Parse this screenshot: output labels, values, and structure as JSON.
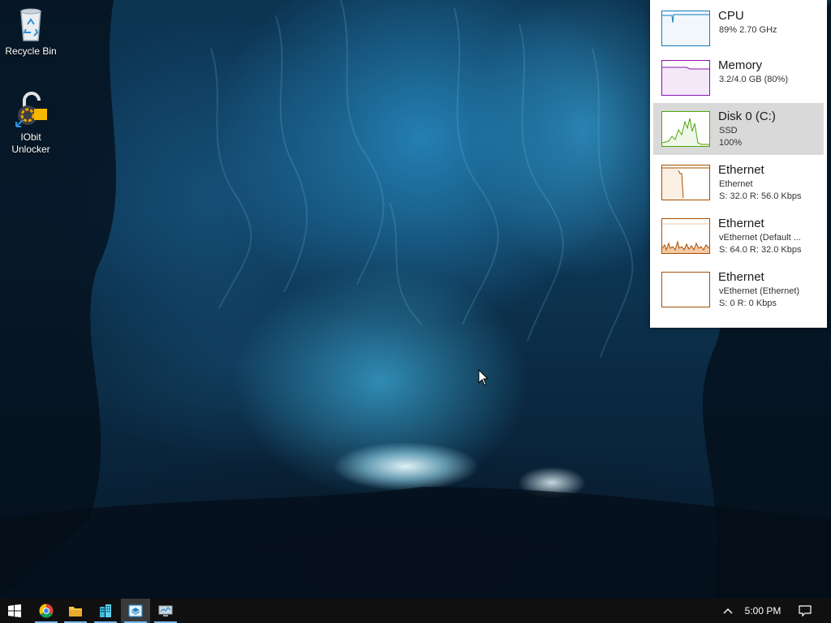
{
  "desktop": {
    "icons": [
      {
        "label": "Recycle Bin",
        "icon": "recycle-bin-icon"
      },
      {
        "label": "IObit Unlocker",
        "icon": "iobit-unlocker-icon"
      }
    ]
  },
  "flyout": {
    "items": [
      {
        "title": "CPU",
        "line1": "89%  2.70 GHz",
        "line2": "",
        "color": "#117dbb",
        "selected": false
      },
      {
        "title": "Memory",
        "line1": "3.2/4.0 GB (80%)",
        "line2": "",
        "color": "#8b12ae",
        "selected": false
      },
      {
        "title": "Disk 0 (C:)",
        "line1": "SSD",
        "line2": "100%",
        "color": "#4da60c",
        "selected": true
      },
      {
        "title": "Ethernet",
        "line1": "Ethernet",
        "line2": "S: 32.0  R: 56.0 Kbps",
        "color": "#a74f01",
        "selected": false
      },
      {
        "title": "Ethernet",
        "line1": "vEthernet (Default ...",
        "line2": "S: 64.0  R: 32.0 Kbps",
        "color": "#a74f01",
        "selected": false
      },
      {
        "title": "Ethernet",
        "line1": "vEthernet (Ethernet)",
        "line2": "S: 0  R: 0 Kbps",
        "color": "#a74f01",
        "selected": false
      }
    ]
  },
  "taskbar": {
    "apps": [
      {
        "name": "start",
        "icon": "windows-logo-icon",
        "active": false,
        "running": false
      },
      {
        "name": "chrome",
        "icon": "chrome-icon",
        "active": false,
        "running": true
      },
      {
        "name": "file-explorer",
        "icon": "folder-icon",
        "active": false,
        "running": true
      },
      {
        "name": "app-buildings",
        "icon": "buildings-icon",
        "active": false,
        "running": true
      },
      {
        "name": "app-box",
        "icon": "app-box-icon",
        "active": true,
        "running": true
      },
      {
        "name": "app-monitor",
        "icon": "monitor-app-icon",
        "active": false,
        "running": true
      }
    ],
    "clock": "5:00 PM",
    "accent": "#76b9ed"
  }
}
